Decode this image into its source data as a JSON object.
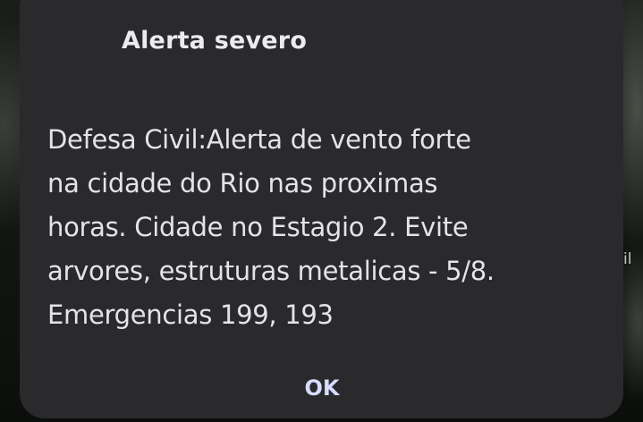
{
  "background": {
    "fragment_text": "il"
  },
  "dialog": {
    "title": "Alerta severo",
    "message_lines": [
      "Defesa Civil:Alerta de vento forte",
      "na cidade do Rio nas proximas",
      "horas. Cidade no Estagio 2. Evite",
      "arvores, estruturas metalicas - 5/8.",
      "Emergencias 199, 193"
    ],
    "ok_label": "OK"
  },
  "colors": {
    "dialog_background": "#2a2a2c",
    "title_text": "#ecebf0",
    "message_text": "#e4e3e8",
    "button_text": "#d6dcff"
  }
}
